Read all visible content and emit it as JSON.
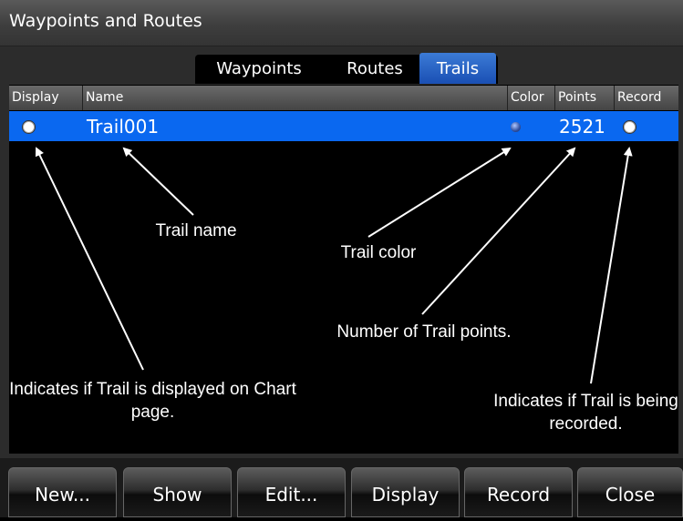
{
  "window": {
    "title": "Waypoints and Routes"
  },
  "tabs": [
    {
      "label": "Waypoints",
      "active": false
    },
    {
      "label": "Routes",
      "active": false
    },
    {
      "label": "Trails",
      "active": true
    }
  ],
  "table": {
    "columns": [
      "Display",
      "Name",
      "Color",
      "Points",
      "Record"
    ],
    "rows": [
      {
        "display": true,
        "name": "Trail001",
        "color": "#3a5bd0",
        "points": "2521",
        "record": false
      }
    ]
  },
  "annotations": {
    "display": "Indicates if Trail is displayed on Chart page.",
    "name": "Trail name",
    "color": "Trail color",
    "points": "Number of Trail points.",
    "record": "Indicates if Trail is being recorded."
  },
  "buttons": [
    "New...",
    "Show",
    "Edit...",
    "Display",
    "Record",
    "Close"
  ],
  "colors": {
    "selection": "#0a68f0",
    "active_tab": "#2a62c8"
  }
}
